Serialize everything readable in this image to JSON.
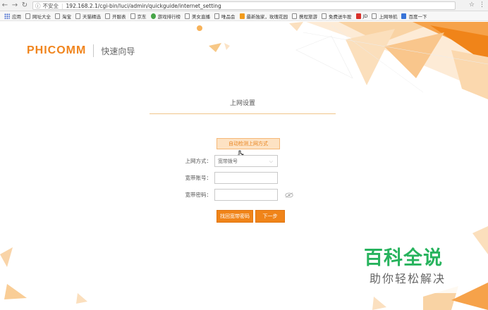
{
  "browser": {
    "security_label": "不安全",
    "url": "192.168.2.1/cgi-bin/luci/admin/quickguide/internet_setting",
    "bookmarks": [
      "应用",
      "网址大全",
      "淘宝",
      "天猫精选",
      "开服表",
      "京东",
      "游戏排行榜",
      "美女直播",
      "唯品会",
      "最新独家，玫瑰花园",
      "携程旅游",
      "免费送牛股",
      "JD",
      "上网导航",
      "百度一下"
    ]
  },
  "brand": {
    "logo": "PHICOMM",
    "subtitle": "快速向导",
    "accent_color": "#f0841c"
  },
  "form": {
    "title": "上网设置",
    "detect_button": "自动检测上网方式",
    "mode_label": "上网方式：",
    "mode_value": "宽带拨号",
    "account_label": "宽带账号：",
    "account_value": "",
    "password_label": "宽带密码：",
    "password_value": "",
    "find_password_button": "找回宽带密码",
    "next_button": "下一步"
  },
  "watermark": {
    "main": "百科全说",
    "sub": "助你轻松解决"
  },
  "icons": [
    "back-icon",
    "forward-icon",
    "reload-icon",
    "info-icon",
    "bookmark-star-icon",
    "menu-icon",
    "eye-icon",
    "cursor-hand-icon"
  ]
}
